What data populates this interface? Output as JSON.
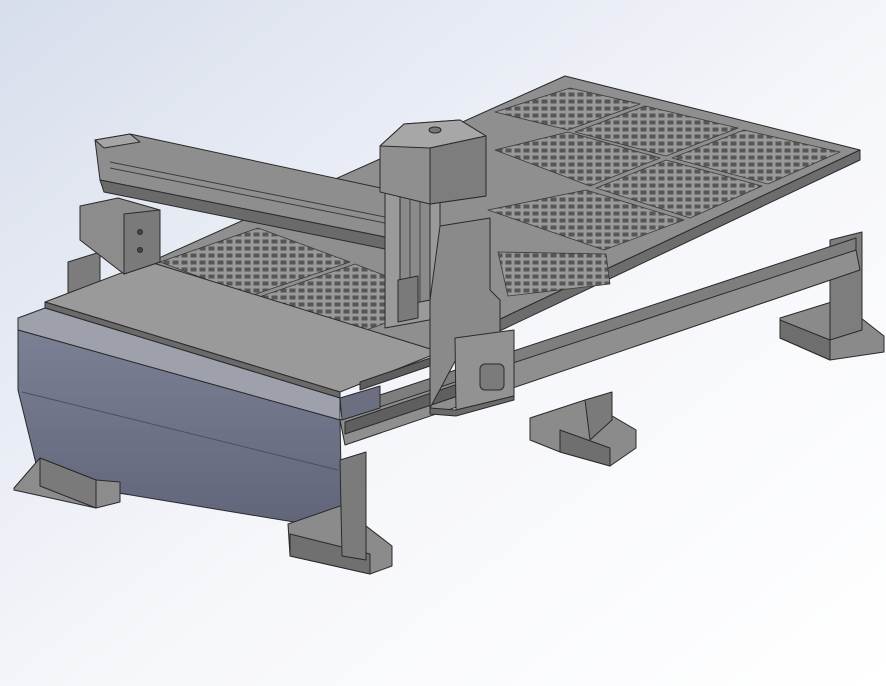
{
  "scene": {
    "model": "cnc-router-gantry-machine",
    "view": "isometric",
    "colors": {
      "background_top": "#dde3ee",
      "background_bottom": "#ffffff",
      "metal": "#8c8c8c",
      "metal_light": "#a3a3a3",
      "metal_dark": "#6b6b6b",
      "table_top": "#8e8e8e",
      "table_grid_hole": "#5c5c5c",
      "cabinet_blue": "#6f7487",
      "cabinet_blue_dark": "#5a5e6e",
      "edge": "#2a2a2a"
    },
    "vacuum_zones": 6
  }
}
